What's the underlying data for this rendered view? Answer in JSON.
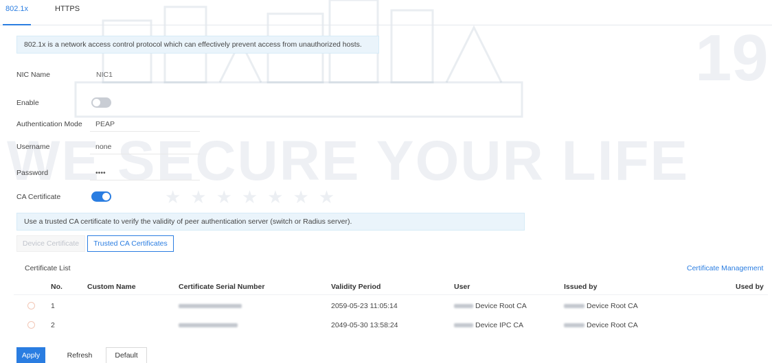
{
  "watermark": {
    "slogan": "WE SECURE YOUR LIFE",
    "year": "19",
    "stars": "★★★★★★★"
  },
  "tabs": [
    {
      "label": "802.1x",
      "active": true
    },
    {
      "label": "HTTPS",
      "active": false
    }
  ],
  "intro_text": "802.1x is a network access control protocol which can effectively prevent access from unauthorized hosts.",
  "form": {
    "nic_name": {
      "label": "NIC Name",
      "value": "NIC1"
    },
    "enable": {
      "label": "Enable",
      "on": false
    },
    "auth_mode": {
      "label": "Authentication Mode",
      "value": "PEAP"
    },
    "username": {
      "label": "Username",
      "value": "none"
    },
    "password": {
      "label": "Password",
      "value": "••••"
    },
    "ca_certificate": {
      "label": "CA Certificate",
      "on": true
    }
  },
  "ca_info_text": "Use a trusted CA certificate to verify the validity of peer authentication server (switch or Radius server).",
  "cert_tabs": {
    "device": "Device Certificate",
    "trusted": "Trusted CA Certificates"
  },
  "certificate_list": {
    "title": "Certificate List",
    "manage_link": "Certificate Management",
    "columns": [
      "No.",
      "Custom Name",
      "Certificate Serial Number",
      "Validity Period",
      "User",
      "Issued by",
      "Used by"
    ],
    "rows": [
      {
        "no": "1",
        "custom_name": "",
        "validity": "2059-05-23 11:05:14",
        "user": "Device Root CA",
        "issued_by": "Device Root CA",
        "used_by": ""
      },
      {
        "no": "2",
        "custom_name": "",
        "validity": "2049-05-30 13:58:24",
        "user": "Device IPC CA",
        "issued_by": "Device Root CA",
        "used_by": ""
      }
    ]
  },
  "buttons": {
    "apply": "Apply",
    "refresh": "Refresh",
    "default": "Default"
  },
  "colors": {
    "accent": "#2a7de1",
    "info_bg": "#eaf4fb"
  }
}
